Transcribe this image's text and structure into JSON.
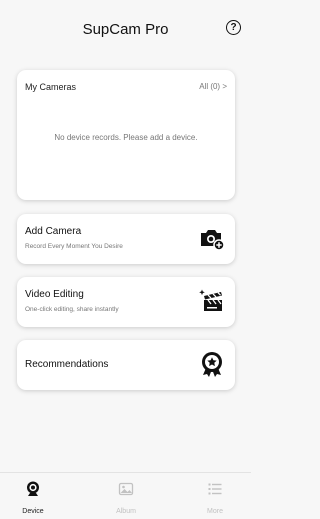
{
  "header": {
    "title": "SupCam Pro",
    "help_label": "?"
  },
  "cameras": {
    "label": "My Cameras",
    "all_link": "All (0) >",
    "empty_text": "No device records. Please add a device."
  },
  "features": [
    {
      "title": "Add Camera",
      "subtitle": "Record Every Moment You Desire",
      "icon": "camera-add-icon"
    },
    {
      "title": "Video Editing",
      "subtitle": "One-click editing, share instantly",
      "icon": "clapperboard-icon"
    },
    {
      "title": "Recommendations",
      "subtitle": "",
      "icon": "award-badge-icon"
    }
  ],
  "tabs": [
    {
      "label": "Device",
      "icon": "webcam-icon",
      "active": true
    },
    {
      "label": "Album",
      "icon": "image-icon",
      "active": false
    },
    {
      "label": "More",
      "icon": "list-icon",
      "active": false
    }
  ],
  "colors": {
    "background": "#f7f7f7",
    "card": "#ffffff",
    "text": "#111111",
    "muted": "#777777",
    "inactive_tab": "#c2c2c2"
  }
}
